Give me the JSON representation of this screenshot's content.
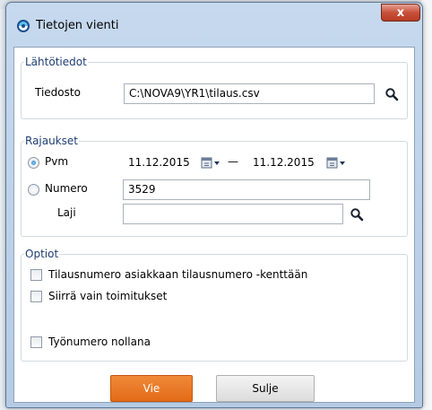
{
  "window": {
    "title": "Tietojen vienti",
    "close_label": "x"
  },
  "source_group": {
    "label": "Lähtötiedot",
    "file_label": "Tiedosto",
    "file_value": "C:\\NOVA9\\YR1\\tilaus.csv",
    "browse_icon": "magnifier-icon"
  },
  "filters_group": {
    "label": "Rajaukset",
    "date_option": {
      "label": "Pvm",
      "selected": true
    },
    "date_from": "11.12.2015",
    "date_separator": "—",
    "date_to": "11.12.2015",
    "number_option": {
      "label": "Numero",
      "selected": false
    },
    "number_value": "3529",
    "type_label": "Laji",
    "type_value": "",
    "calendar_icon": "calendar-dropdown-icon"
  },
  "options_group": {
    "label": "Optiot",
    "checkboxes": [
      {
        "label": "Tilausnumero asiakkaan tilausnumero -kenttään",
        "checked": false
      },
      {
        "label": "Siirrä vain toimitukset",
        "checked": false
      },
      {
        "label": "Työnumero nollana",
        "checked": false
      }
    ]
  },
  "buttons": {
    "export_label": "Vie",
    "close_label": "Sulje"
  },
  "colors": {
    "accent": "#E8731F",
    "group_label": "#1F3D72"
  }
}
